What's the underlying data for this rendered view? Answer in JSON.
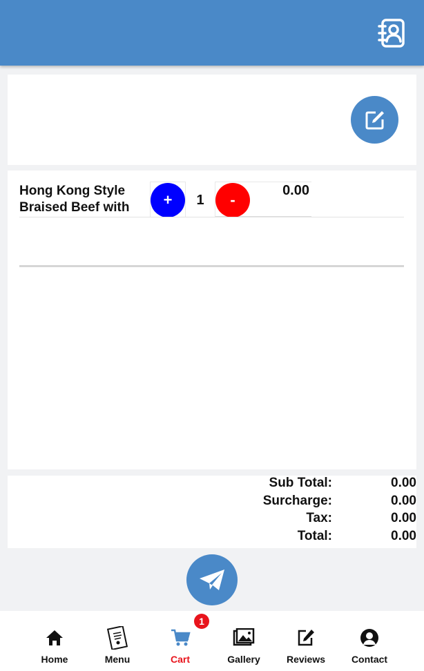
{
  "header": {
    "contacts_icon": "contact-book-icon"
  },
  "edit_button": {
    "icon": "edit-icon"
  },
  "cart": {
    "items": [
      {
        "name": "Hong Kong Style Braised Beef with",
        "plus_label": "+",
        "minus_label": "-",
        "quantity": "1",
        "price": "0.00"
      }
    ]
  },
  "totals": {
    "sub_total_label": "Sub Total:",
    "sub_total": "0.00",
    "surcharge_label": "Surcharge:",
    "surcharge": "0.00",
    "tax_label": "Tax:",
    "tax": "0.00",
    "total_label": "Total:",
    "total": "0.00"
  },
  "send_button": {
    "icon": "paper-plane-icon"
  },
  "nav": {
    "home": "Home",
    "menu": "Menu",
    "cart": "Cart",
    "gallery": "Gallery",
    "reviews": "Reviews",
    "contact": "Contact",
    "cart_badge": "1"
  },
  "colors": {
    "primary": "#4a89c8",
    "plus": "#0000ff",
    "minus": "#ff0000",
    "active": "#e8141c"
  }
}
